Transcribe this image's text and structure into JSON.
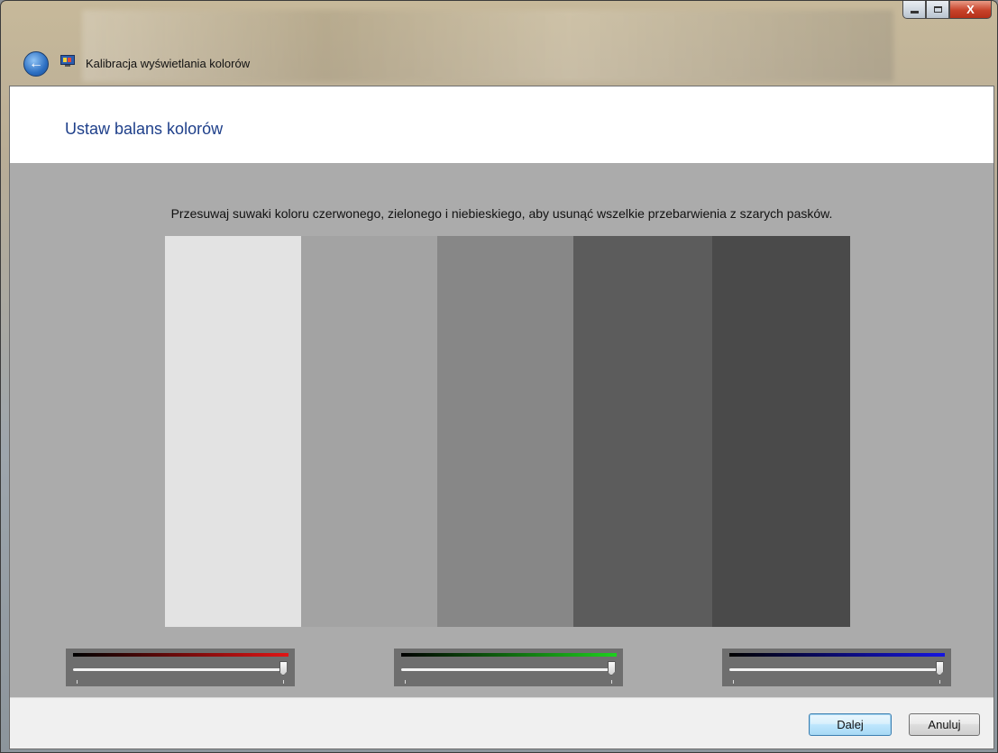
{
  "window": {
    "title": "Kalibracja wyświetlania kolorów",
    "close_glyph": "X"
  },
  "page": {
    "title": "Ustaw balans kolorów",
    "instruction": "Przesuwaj suwaki koloru czerwonego, zielonego i niebieskiego, aby usunąć wszelkie przebarwienia z szarych pasków."
  },
  "gray_bars": [
    {
      "color": "#e3e3e3"
    },
    {
      "color": "#a3a3a3"
    },
    {
      "color": "#878787"
    },
    {
      "color": "#5c5c5c"
    },
    {
      "color": "#4a4a4a"
    }
  ],
  "sliders": [
    {
      "name": "red",
      "color": "#e01515",
      "value": 1.0
    },
    {
      "name": "green",
      "color": "#1ed01e",
      "value": 1.0
    },
    {
      "name": "blue",
      "color": "#1515e0",
      "value": 1.0
    }
  ],
  "footer": {
    "next_label": "Dalej",
    "cancel_label": "Anuluj"
  }
}
